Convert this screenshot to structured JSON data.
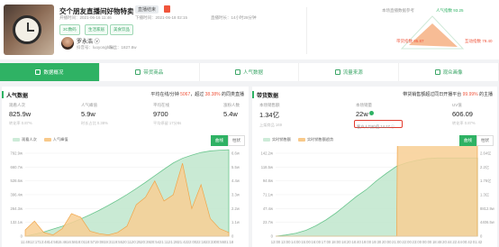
{
  "header": {
    "title": "交个朋友直播间好物特卖",
    "tag": "直播结束",
    "start_time": "开播时间：2021-06-16 11:46",
    "end_time": "下播时间：2021-06-18 02:15",
    "duration": "直播时长：14小时28分钟",
    "tags": [
      "3C数码",
      "生活家居",
      "美食饮品"
    ],
    "anchor_name": "罗永浩 ⓥ",
    "anchor_id": "抖音号：luoyonghao",
    "fans": "粉丝：1827.8w",
    "check_label": "本场直播数据参考",
    "triangle": {
      "top": "人气指数 93.25",
      "left": "带货指数 95.87",
      "right": "互动指数 79.40"
    }
  },
  "tabs": [
    "数据概况",
    "带货商品",
    "人气数据",
    "流量来源",
    "观众画像"
  ],
  "left_panel": {
    "title": "人气数据",
    "summary_prefix": "平均在线/分钟 ",
    "summary_value": "5067",
    "summary_suffix": "，超过 ",
    "summary_pct": "38.38%",
    "summary_end": " 的同类直播",
    "stats": [
      {
        "label": "观看人次",
        "value": "825.9w",
        "sub": "转化率 0.87%"
      },
      {
        "label": "人气峰值",
        "value": "5.9w",
        "sub": "时长占比 0.38%"
      },
      {
        "label": "平均在线",
        "value": "9700",
        "sub": "平均停留 17分8s"
      },
      {
        "label": "涨粉人数",
        "value": "5.4w",
        "sub": ""
      }
    ],
    "legend": [
      "观看人次",
      "人气峰值"
    ],
    "mode": [
      "曲线",
      "柱状"
    ]
  },
  "right_panel": {
    "title": "带货数据",
    "summary_prefix": "带货销售额超过同日开播平台 ",
    "summary_pct": "99.99%",
    "summary_end": " 的主播",
    "stats": [
      {
        "label": "本场销售额",
        "value": "1.34亿",
        "sub": "上架商品 169"
      },
      {
        "label": "本场销量",
        "value": "22w",
        "sub": "客单价 / 609.46"
      },
      {
        "label": "UV值",
        "value": "606.09",
        "sub": "转化率 0.87%"
      }
    ],
    "highlight": "客户人均价值 14.17 ⓘ",
    "legend": [
      "实时销售额",
      "实时销售额趋势"
    ],
    "mode": [
      "曲线",
      "柱状"
    ]
  },
  "chart_data": [
    {
      "type": "area",
      "title": "人气数据",
      "series": [
        {
          "name": "观看人次",
          "values": [
            0,
            18,
            40,
            68,
            95,
            128,
            165,
            205,
            248,
            295,
            345,
            398,
            455,
            515,
            578,
            640,
            700,
            745,
            775,
            800,
            815,
            822,
            826
          ]
        },
        {
          "name": "人气峰值",
          "values": [
            0.5,
            1.2,
            0.3,
            0.1,
            0.6,
            1.8,
            1.5,
            0.4,
            0.2,
            0.1,
            0.3,
            0.8,
            2.5,
            3.1,
            4.4,
            2.8,
            3.3,
            5.8,
            2.2,
            4.1,
            1.4,
            0.6,
            0.3
          ]
        }
      ],
      "x": [
        "11:49",
        "12:17",
        "13:48",
        "14:58",
        "15:46",
        "16:58",
        "18:01",
        "18:57",
        "19:08",
        "19:31",
        "19:55",
        "20:11",
        "20:25",
        "20:39",
        "20:54",
        "21:11",
        "21:28",
        "21:42",
        "22:00",
        "22:18",
        "23:33",
        "00:55",
        "01:18"
      ],
      "y_left_ticks": [
        "0",
        "132.1w",
        "264.3w",
        "396.4w",
        "528.6w",
        "660.7w",
        "792.9w"
      ],
      "y_right_ticks": [
        "0",
        "1.1w",
        "2.2w",
        "3.3w",
        "4.4w",
        "5.5w",
        "6.6w"
      ],
      "ylim": [
        0,
        792.9
      ],
      "y2lim": [
        0,
        6.6
      ]
    },
    {
      "type": "area",
      "title": "带货数据",
      "series": [
        {
          "name": "实时销售额",
          "values": [
            0,
            2,
            5,
            10,
            18,
            28,
            40,
            54,
            68,
            80,
            95,
            108,
            120,
            126,
            130,
            133,
            134,
            134,
            134,
            134,
            134
          ]
        },
        {
          "name": "实时销售额趋势",
          "values": [
            0,
            0,
            0,
            0,
            0,
            0,
            0,
            0,
            0,
            0,
            0,
            0,
            0,
            42,
            42,
            42,
            42,
            42,
            42,
            42,
            42
          ]
        }
      ],
      "x": [
        "12:00",
        "13:00",
        "14:00",
        "15:00",
        "16:00",
        "17:00",
        "18:00",
        "18:20",
        "18:40",
        "19:00",
        "19:30",
        "20:00",
        "21:00",
        "22:00",
        "23:00",
        "00:00",
        "18:48",
        "20:44",
        "22:44",
        "00:42",
        "01:42"
      ],
      "y_left_ticks": [
        "0",
        "23.7w",
        "47.4w",
        "71.1w",
        "94.8w",
        "118.5w",
        "142.2w"
      ],
      "y_right_ticks": [
        "0",
        "4406.5w",
        "8812.9w",
        "1.3亿",
        "1.76亿",
        "2.2亿",
        "2.64亿"
      ],
      "ylim": [
        0,
        142.2
      ],
      "y2lim": [
        0,
        2.64
      ]
    }
  ],
  "colors": {
    "accent": "#2fb264",
    "orange": "#f5a623",
    "red": "#f0553c"
  }
}
